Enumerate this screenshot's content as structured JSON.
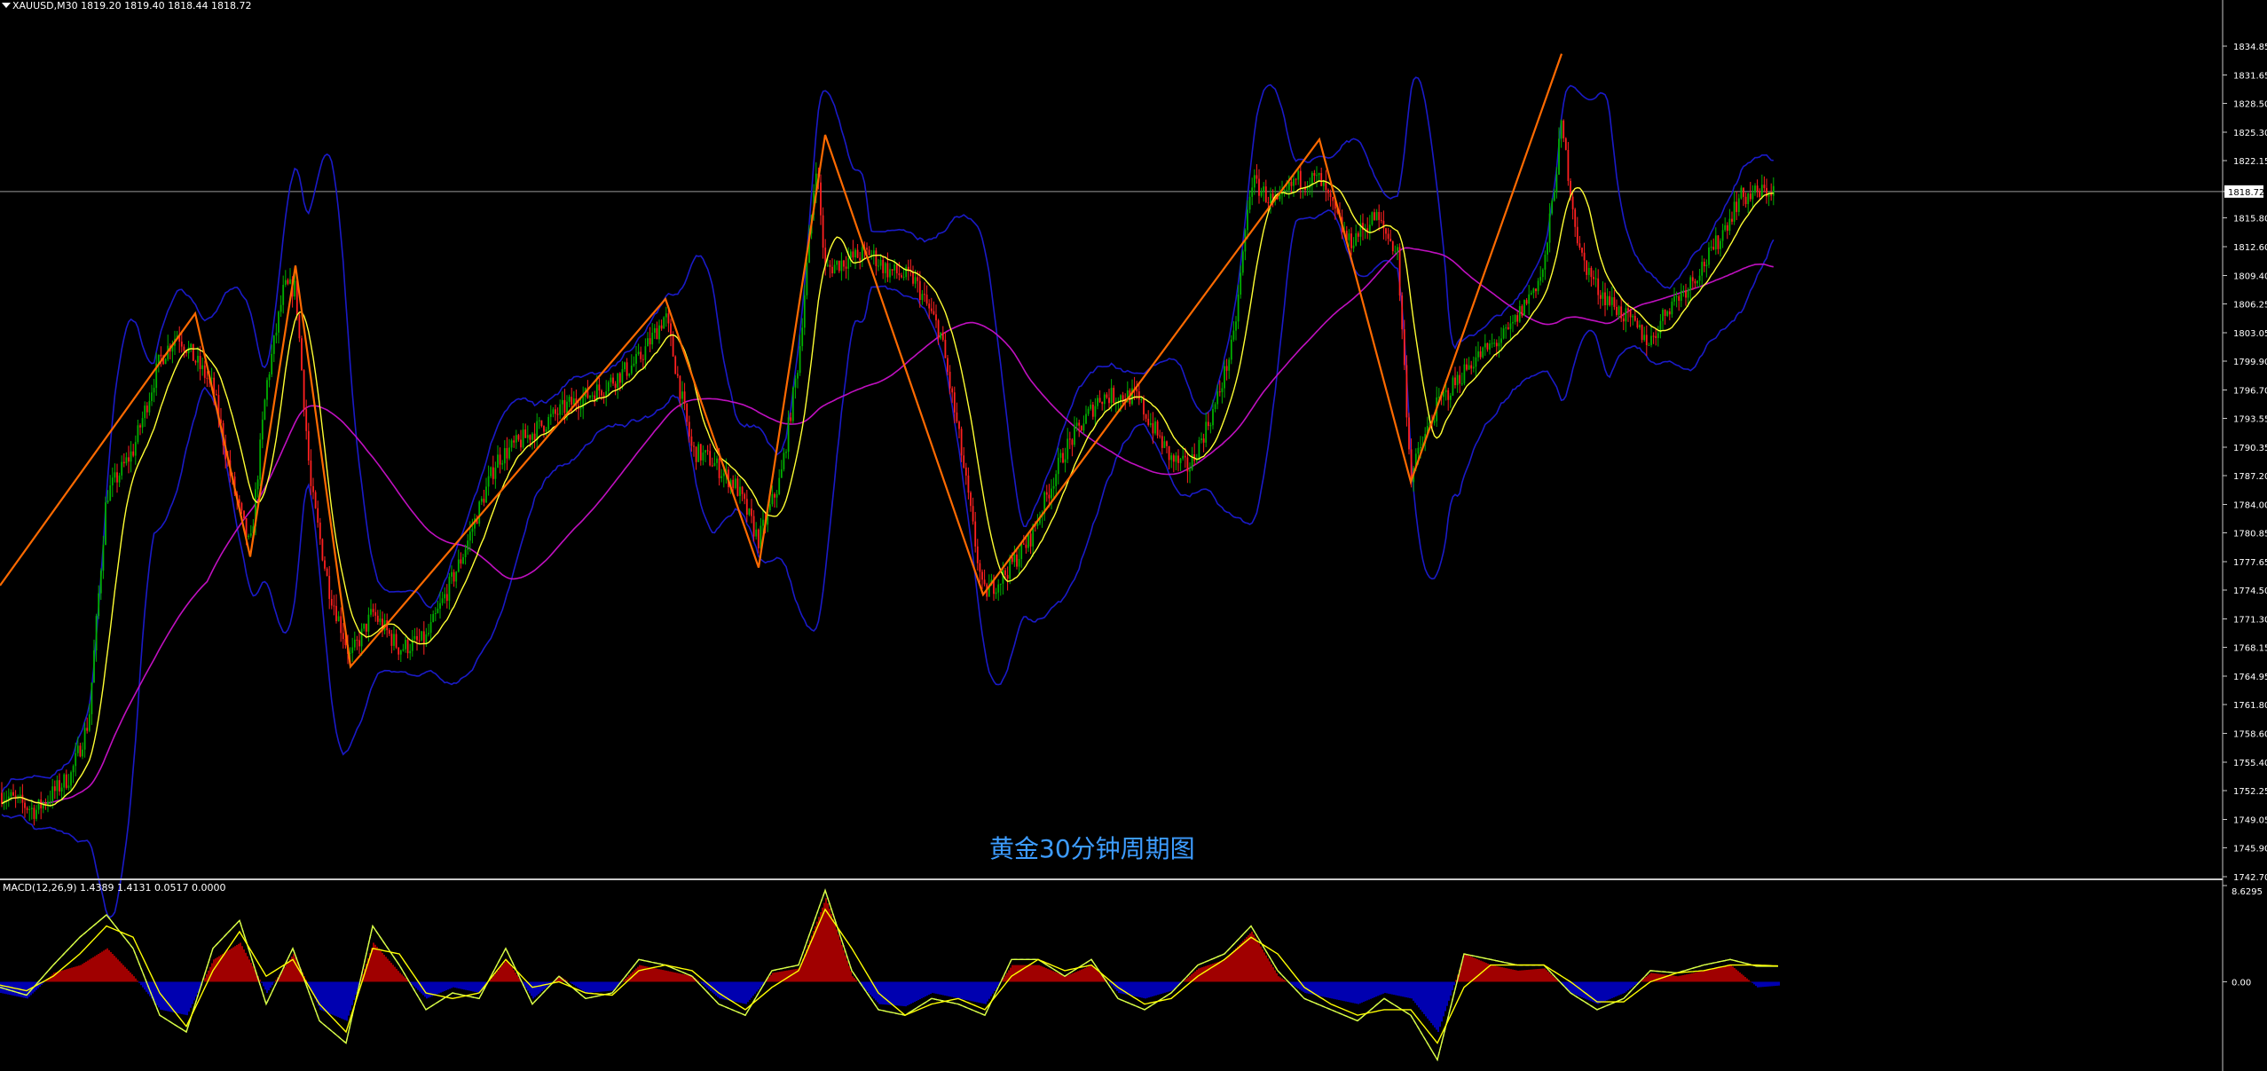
{
  "window": {
    "symbol_header": "XAUUSD,M30  1819.20 1819.40 1818.44 1818.72",
    "caption": "黄金30分钟周期图"
  },
  "price_axis": {
    "ticks": [
      "1834.85",
      "1831.65",
      "1828.50",
      "1825.30",
      "1822.15",
      "1818.72",
      "1815.80",
      "1812.60",
      "1809.40",
      "1806.25",
      "1803.05",
      "1799.90",
      "1796.70",
      "1793.55",
      "1790.35",
      "1787.20",
      "1784.00",
      "1780.85",
      "1777.65",
      "1774.50",
      "1771.30",
      "1768.15",
      "1764.95",
      "1761.80",
      "1758.60",
      "1755.40",
      "1752.25",
      "1749.05",
      "1745.90",
      "1742.70"
    ],
    "current_price": "1818.72",
    "range": [
      1742.7,
      1838.0
    ]
  },
  "macd": {
    "header": "MACD(12,26,9) 1.4389 1.4131 0.0517 0.0000",
    "ticks": [
      "8.6295",
      "0.00"
    ],
    "range": [
      -8.0,
      8.6295
    ]
  },
  "colors": {
    "background": "#000000",
    "candle_up": "#00b000",
    "candle_down": "#ff2020",
    "zigzag": "#ff6a00",
    "bollinger": "#1a1ac8",
    "ma_fast": "#ffff33",
    "ma_slow": "#c010c0",
    "macd_pos": "#a00000",
    "macd_neg": "#0000b0",
    "macd_line": "#ffffff",
    "signal_line": "#ffff00",
    "caption": "#3d9cff"
  },
  "chart_data": [
    {
      "type": "candlestick",
      "title": "XAUUSD,M30",
      "ylim": [
        1742.7,
        1838.0
      ],
      "zigzag": {
        "x": [
          0,
          220,
          282,
          333,
          395,
          750,
          855,
          930,
          1108,
          1487,
          1590,
          1760,
          1725
        ],
        "y": [
          1775.0,
          1805.2,
          1778.2,
          1810.5,
          1766.0,
          1806.8,
          1777.0,
          1825.0,
          1774.0,
          1824.5,
          1786.5,
          1834.0,
          1834.0
        ]
      },
      "series": [
        {
          "name": "close",
          "x": [
            0,
            40,
            80,
            100,
            120,
            150,
            180,
            200,
            220,
            240,
            260,
            282,
            300,
            320,
            333,
            350,
            370,
            395,
            420,
            450,
            480,
            520,
            560,
            600,
            640,
            680,
            720,
            750,
            780,
            800,
            830,
            855,
            880,
            900,
            920,
            930,
            950,
            980,
            1000,
            1030,
            1060,
            1080,
            1108,
            1130,
            1160,
            1200,
            1240,
            1280,
            1320,
            1340,
            1370,
            1390,
            1410,
            1440,
            1460,
            1487,
            1520,
            1550,
            1575,
            1590,
            1600,
            1620,
            1660,
            1700,
            1740,
            1760,
            1780,
            1800,
            1830,
            1860,
            1880,
            1900,
            1930,
            1960,
            2000
          ],
          "y": [
            1752,
            1750,
            1754,
            1760,
            1785,
            1790,
            1800,
            1803,
            1800,
            1797,
            1787,
            1779,
            1797,
            1808,
            1808,
            1786,
            1775,
            1767,
            1772,
            1768,
            1769,
            1778,
            1789,
            1792,
            1795,
            1797,
            1800,
            1805,
            1790,
            1789,
            1786,
            1780,
            1787,
            1800,
            1822,
            1810,
            1811,
            1812,
            1810,
            1809,
            1803,
            1792,
            1774,
            1776,
            1780,
            1790,
            1796,
            1796,
            1789,
            1788,
            1795,
            1802,
            1820,
            1817,
            1820,
            1820,
            1813,
            1816,
            1812,
            1787,
            1790,
            1795,
            1800,
            1803,
            1810,
            1826,
            1812,
            1808,
            1805,
            1802,
            1806,
            1808,
            1812,
            1818,
            1819
          ]
        }
      ]
    },
    {
      "type": "bar",
      "title": "MACD(12,26,9)",
      "ylim": [
        -8.0,
        8.6295
      ],
      "x": [
        0,
        30,
        60,
        90,
        120,
        150,
        180,
        210,
        240,
        270,
        300,
        330,
        360,
        390,
        420,
        450,
        480,
        510,
        540,
        570,
        600,
        630,
        660,
        690,
        720,
        750,
        780,
        810,
        840,
        870,
        900,
        930,
        960,
        990,
        1020,
        1050,
        1080,
        1110,
        1140,
        1170,
        1200,
        1230,
        1260,
        1290,
        1320,
        1350,
        1380,
        1410,
        1440,
        1470,
        1500,
        1530,
        1560,
        1590,
        1620,
        1650,
        1680,
        1710,
        1740,
        1770,
        1800,
        1830,
        1860,
        1890,
        1920,
        1950,
        1980,
        2010
      ],
      "values": [
        -1.0,
        -1.5,
        0.8,
        1.5,
        3.0,
        0.5,
        -2.5,
        -3.0,
        2.0,
        3.5,
        -1.0,
        2.5,
        -2.5,
        -3.5,
        3.5,
        0.8,
        -1.5,
        -0.5,
        -1.0,
        2.0,
        -1.5,
        0.5,
        -1.0,
        -0.8,
        1.5,
        1.0,
        0.5,
        -1.5,
        -2.0,
        0.8,
        1.2,
        7.5,
        0.5,
        -2.0,
        -2.2,
        -1.0,
        -1.5,
        -2.0,
        1.5,
        1.5,
        0.5,
        1.5,
        -1.0,
        -1.5,
        -0.8,
        1.2,
        2.0,
        4.5,
        0.5,
        -1.0,
        -1.5,
        -2.0,
        -1.0,
        -1.5,
        -4.5,
        2.5,
        1.5,
        1.0,
        1.2,
        -1.0,
        -2.0,
        -1.0,
        0.8,
        0.5,
        1.0,
        1.5,
        -0.5,
        -0.3
      ],
      "series": [
        {
          "name": "MACD",
          "values": [
            -0.5,
            -1.2,
            1.5,
            4.0,
            6.0,
            3.0,
            -3.0,
            -4.5,
            3.0,
            5.5,
            -2.0,
            3.0,
            -3.5,
            -5.5,
            5.0,
            1.5,
            -2.5,
            -1.0,
            -1.5,
            3.0,
            -2.0,
            0.5,
            -1.5,
            -1.0,
            2.0,
            1.5,
            0.5,
            -2.0,
            -3.0,
            1.0,
            1.5,
            8.2,
            1.0,
            -2.5,
            -3.0,
            -1.5,
            -2.0,
            -3.0,
            2.0,
            2.0,
            0.5,
            2.0,
            -1.5,
            -2.5,
            -1.0,
            1.5,
            2.5,
            5.0,
            1.0,
            -1.5,
            -2.5,
            -3.5,
            -1.5,
            -3.0,
            -7.0,
            2.5,
            2.0,
            1.5,
            1.5,
            -1.0,
            -2.5,
            -1.5,
            1.0,
            0.8,
            1.5,
            2.0,
            1.4,
            1.4
          ]
        },
        {
          "name": "Signal",
          "values": [
            -0.3,
            -0.8,
            0.5,
            2.5,
            5.0,
            4.0,
            -1.0,
            -4.0,
            1.0,
            4.5,
            0.5,
            2.0,
            -2.0,
            -4.5,
            3.0,
            2.5,
            -1.0,
            -1.5,
            -1.0,
            2.0,
            -0.5,
            0.0,
            -1.0,
            -1.2,
            1.0,
            1.5,
            1.0,
            -1.0,
            -2.5,
            -0.5,
            1.0,
            6.5,
            3.0,
            -1.0,
            -3.0,
            -2.0,
            -1.5,
            -2.5,
            0.5,
            2.0,
            1.0,
            1.5,
            -0.5,
            -2.0,
            -1.5,
            0.5,
            2.0,
            4.0,
            2.5,
            -0.5,
            -2.0,
            -3.0,
            -2.5,
            -2.5,
            -5.5,
            -0.5,
            1.5,
            1.5,
            1.5,
            0.0,
            -1.8,
            -1.8,
            0.0,
            0.8,
            1.0,
            1.5,
            1.5,
            1.4
          ]
        }
      ]
    }
  ]
}
